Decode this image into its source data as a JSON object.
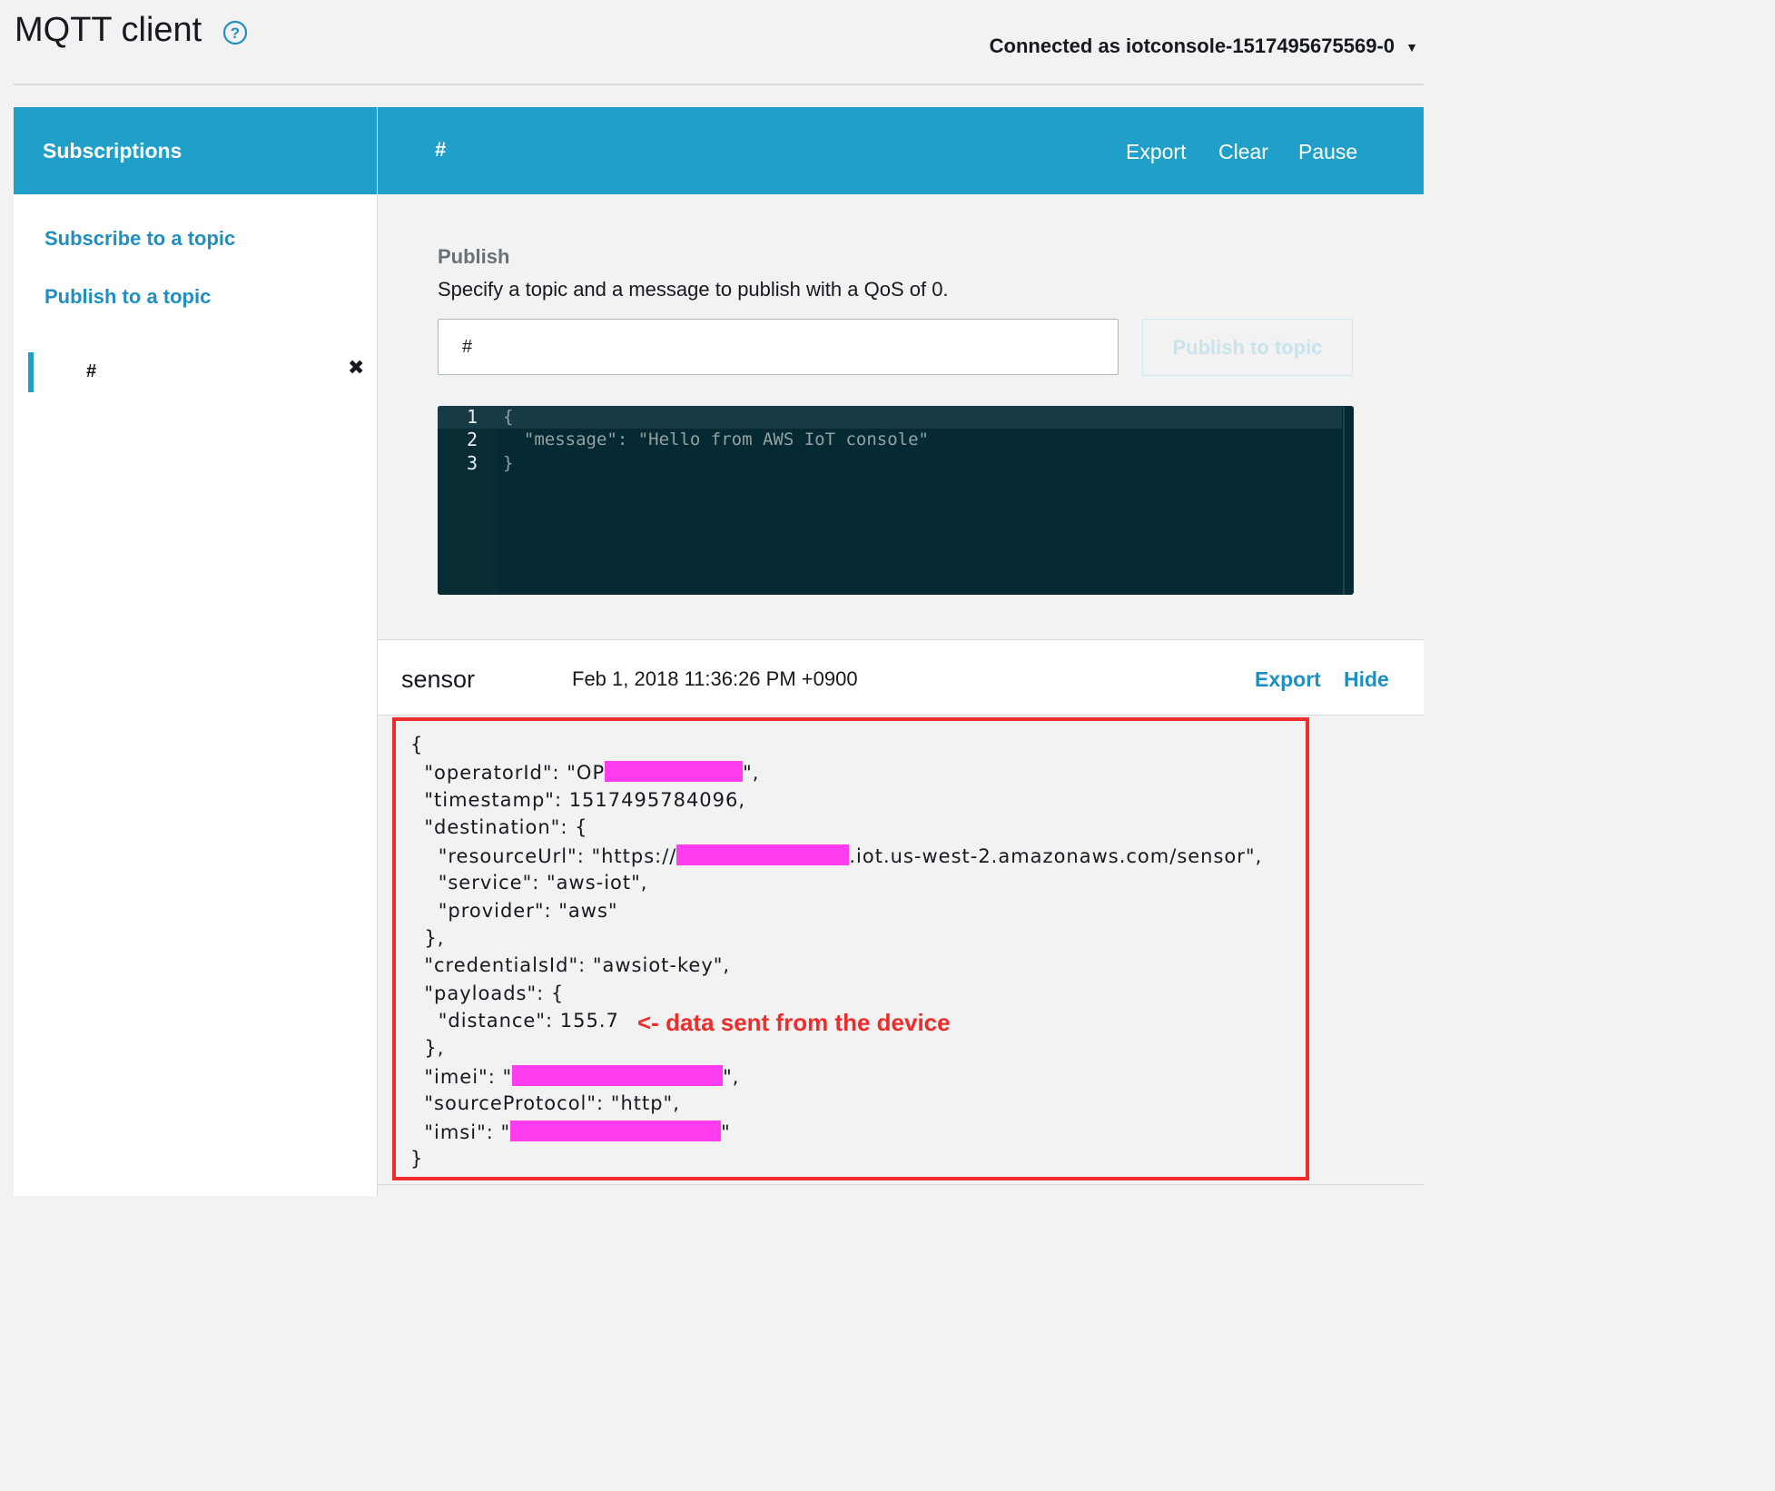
{
  "header": {
    "title": "MQTT client",
    "help_icon": "question-circle-icon",
    "connection": "Connected as iotconsole-1517495675569-0"
  },
  "sidebar": {
    "heading": "Subscriptions",
    "links": [
      "Subscribe to a topic",
      "Publish to a topic"
    ],
    "subscriptions": [
      {
        "topic": "#"
      }
    ]
  },
  "main": {
    "topic": "#",
    "actions": {
      "export": "Export",
      "clear": "Clear",
      "pause": "Pause"
    }
  },
  "publish": {
    "title": "Publish",
    "description": "Specify a topic and a message to publish with a QoS of 0.",
    "topic_value": "#",
    "button": "Publish to topic",
    "editor_lines": [
      "{",
      "  \"message\": \"Hello from AWS IoT console\"",
      "}"
    ]
  },
  "message": {
    "topic": "sensor",
    "timestamp": "Feb 1, 2018 11:36:26 PM +0900",
    "actions": {
      "export": "Export",
      "hide": "Hide"
    },
    "payload_lines": [
      "{",
      "  \"operatorId\": \"OP",
      "  \"timestamp\": 1517495784096,",
      "  \"destination\": {",
      "    \"resourceUrl\": \"https://",
      "    \"service\": \"aws-iot\",",
      "    \"provider\": \"aws\"",
      "  },",
      "  \"credentialsId\": \"awsiot-key\",",
      "  \"payloads\": {",
      "    \"distance\": 155.7",
      "  },",
      "  \"imei\": \"",
      "  \"sourceProtocol\": \"http\",",
      "  \"imsi\": \"",
      "}"
    ],
    "payload_suffixes": {
      "operatorId": "\",",
      "resourceUrl": ".iot.us-west-2.amazonaws.com/sensor\",",
      "imei": "\",",
      "imsi": "\""
    },
    "annotation": "<- data sent from the device",
    "annotation_color": "#ee2c2c",
    "redaction_color": "#ff3cf0"
  },
  "colors": {
    "accent": "#20a0c8",
    "link": "#1f8fbf",
    "editor_bg": "#052a33"
  }
}
